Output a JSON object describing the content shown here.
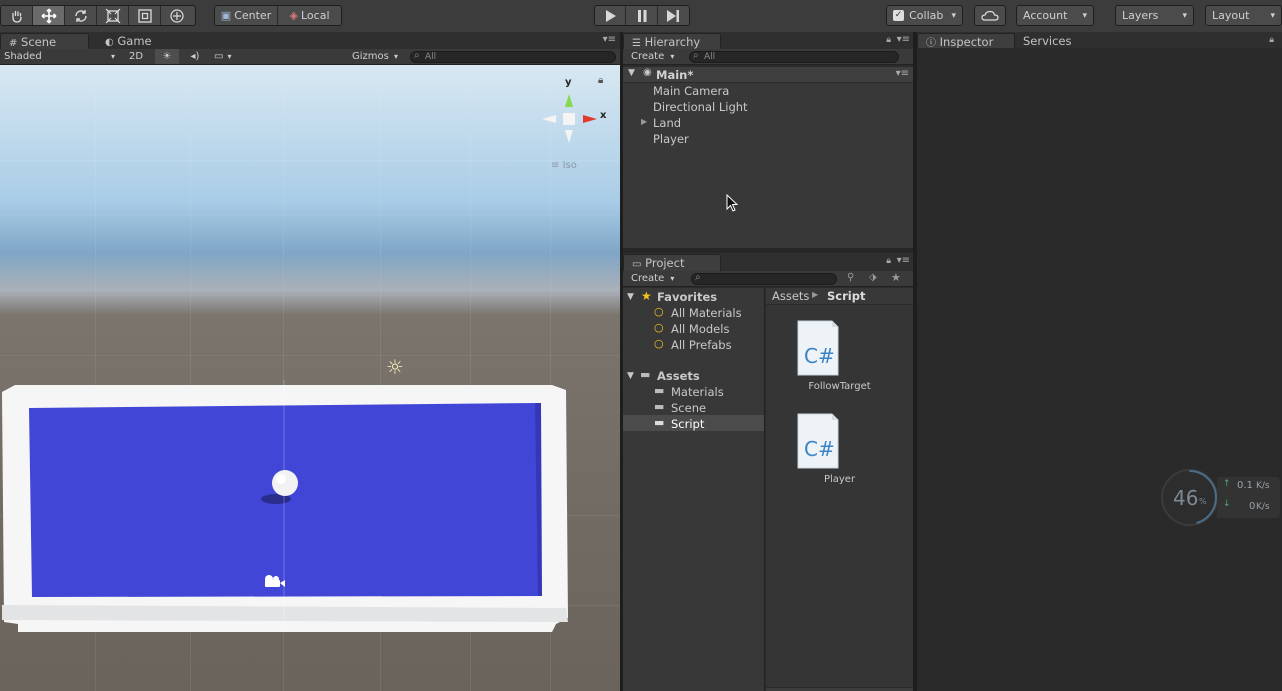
{
  "toolbar": {
    "tools": [
      "hand-tool",
      "move-tool",
      "rotate-tool",
      "scale-tool",
      "rect-tool",
      "transform-tool"
    ],
    "pivot_label": "Center",
    "space_label": "Local",
    "collab_label": "Collab",
    "account_label": "Account",
    "layers_label": "Layers",
    "layout_label": "Layout"
  },
  "scene": {
    "tabs": {
      "scene": "Scene",
      "game": "Game"
    },
    "shading_mode": "Shaded",
    "mode_2d": "2D",
    "gizmos_label": "Gizmos",
    "search_placeholder": "All",
    "gizmo": {
      "y": "y",
      "x": "x",
      "projection": "Iso"
    }
  },
  "hierarchy": {
    "tab_label": "Hierarchy",
    "create_label": "Create",
    "search_placeholder": "All",
    "scene_name": "Main*",
    "items": [
      {
        "label": "Main Camera"
      },
      {
        "label": "Directional Light"
      },
      {
        "label": "Land"
      },
      {
        "label": "Player"
      }
    ]
  },
  "project": {
    "tab_label": "Project",
    "create_label": "Create",
    "favorites_label": "Favorites",
    "favorites": [
      "All Materials",
      "All Models",
      "All Prefabs"
    ],
    "assets_label": "Assets",
    "folders": [
      "Materials",
      "Scene",
      "Script"
    ],
    "selected_folder": "Script",
    "breadcrumb": {
      "root": "Assets",
      "current": "Script"
    },
    "files": [
      {
        "name": "FollowTarget",
        "type": "C#"
      },
      {
        "name": "Player",
        "type": "C#"
      }
    ]
  },
  "inspector": {
    "tabs": {
      "inspector": "Inspector",
      "services": "Services"
    }
  },
  "perf_widget": {
    "percent": "46",
    "unit": "%",
    "upload": "0.1",
    "upload_unit": "K/s",
    "download": "0",
    "download_unit": "K/s"
  },
  "colors": {
    "plane_blue": "#4146d6",
    "collab_accent": "#6ec1f2"
  }
}
